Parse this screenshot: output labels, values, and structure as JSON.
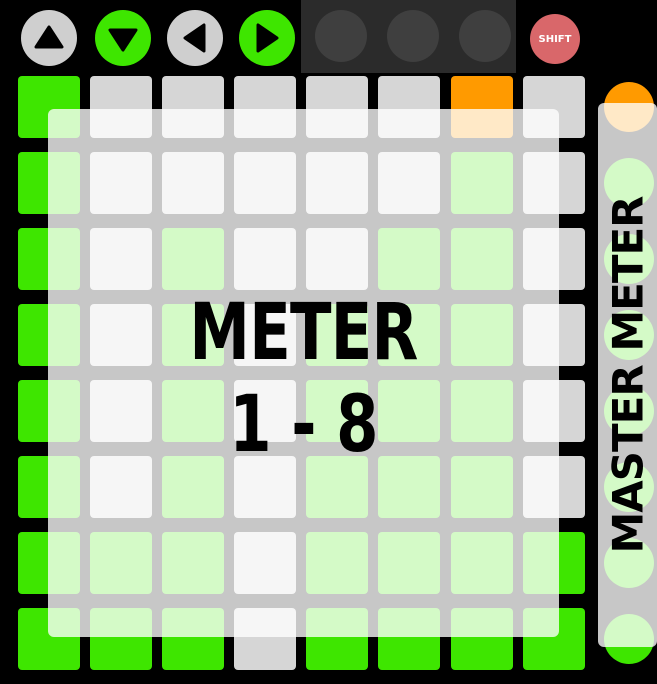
{
  "top_buttons": [
    {
      "icon": "up-arrow-icon",
      "state": "off"
    },
    {
      "icon": "down-arrow-icon",
      "state": "green"
    },
    {
      "icon": "left-arrow-icon",
      "state": "off"
    },
    {
      "icon": "right-arrow-icon",
      "state": "green"
    }
  ],
  "shift_label": "SHIFT",
  "overlay": {
    "title": "METER",
    "subtitle": "1 - 8"
  },
  "master_label": "MASTER METER",
  "grid": [
    [
      "G",
      "W",
      "W",
      "W",
      "W",
      "W",
      "O",
      "W"
    ],
    [
      "G",
      "W",
      "W",
      "W",
      "W",
      "W",
      "G",
      "W"
    ],
    [
      "G",
      "W",
      "G",
      "W",
      "W",
      "G",
      "G",
      "W"
    ],
    [
      "G",
      "W",
      "G",
      "W",
      "G",
      "G",
      "G",
      "W"
    ],
    [
      "G",
      "W",
      "G",
      "W",
      "G",
      "G",
      "G",
      "W"
    ],
    [
      "G",
      "W",
      "G",
      "W",
      "G",
      "G",
      "G",
      "W"
    ],
    [
      "G",
      "G",
      "G",
      "W",
      "G",
      "G",
      "G",
      "G"
    ],
    [
      "G",
      "G",
      "G",
      "W",
      "G",
      "G",
      "G",
      "G"
    ]
  ],
  "scene_buttons": [
    "O",
    "G",
    "G",
    "G",
    "G",
    "G",
    "G",
    "G"
  ],
  "colors": {
    "green": "#3ee600",
    "white": "#d6d6d6",
    "orange": "#ff9a00",
    "shift": "#d9676a",
    "icon_grey": "#cfcfcf"
  }
}
